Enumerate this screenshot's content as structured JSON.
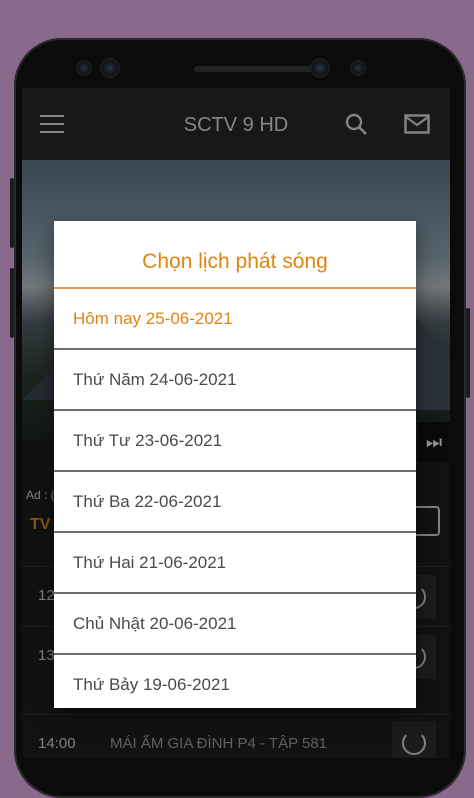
{
  "app": {
    "title": "SCTV 9 HD"
  },
  "player": {
    "ad_label": "Ad : (",
    "next_symbol": "⏭"
  },
  "tabs": {
    "tv_label": "TV"
  },
  "schedule": [
    {
      "time": "12",
      "name": ""
    },
    {
      "time": "13",
      "name": ""
    },
    {
      "time": "14:00",
      "name": "MÁI ẤM GIA ĐÌNH P4 - TẬP 581"
    }
  ],
  "dialog": {
    "title": "Chọn lịch phát sóng",
    "dates": [
      {
        "label": "Hôm nay 25-06-2021",
        "selected": true
      },
      {
        "label": "Thứ Năm 24-06-2021",
        "selected": false
      },
      {
        "label": "Thứ Tư 23-06-2021",
        "selected": false
      },
      {
        "label": "Thứ Ba 22-06-2021",
        "selected": false
      },
      {
        "label": "Thứ Hai 21-06-2021",
        "selected": false
      },
      {
        "label": "Chủ Nhật 20-06-2021",
        "selected": false
      },
      {
        "label": "Thứ Bảy 19-06-2021",
        "selected": false
      }
    ]
  },
  "colors": {
    "accent": "#e08410",
    "background": "#8a6a8c",
    "appbar": "#282828"
  },
  "icons": [
    "menu-icon",
    "search-icon",
    "mail-icon",
    "calendar-icon",
    "replay-icon",
    "next-icon"
  ]
}
